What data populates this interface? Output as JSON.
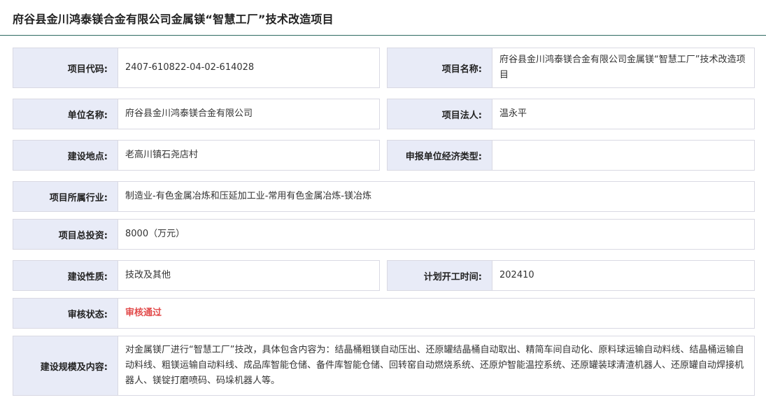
{
  "header": {
    "title": "府谷县金川鸿泰镁合金有限公司金属镁“智慧工厂”技术改造项目"
  },
  "fields": {
    "project_code": {
      "label": "项目代码:",
      "value": "2407-610822-04-02-614028"
    },
    "project_name": {
      "label": "项目名称:",
      "value": "府谷县金川鸿泰镁合金有限公司金属镁“智慧工厂”技术改造项目"
    },
    "unit_name": {
      "label": "单位名称:",
      "value": "府谷县金川鸿泰镁合金有限公司"
    },
    "legal_person": {
      "label": "项目法人:",
      "value": "温永平"
    },
    "location": {
      "label": "建设地点:",
      "value": "老高川镇石尧店村"
    },
    "economic_type": {
      "label": "申报单位经济类型:",
      "value": ""
    },
    "industry": {
      "label": "项目所属行业:",
      "value": "制造业-有色金属冶炼和压延加工业-常用有色金属冶炼-镁冶炼"
    },
    "investment": {
      "label": "项目总投资:",
      "value": "8000（万元）"
    },
    "nature": {
      "label": "建设性质:",
      "value": "技改及其他"
    },
    "start_time": {
      "label": "计划开工时间:",
      "value": "202410"
    },
    "review_status": {
      "label": "审核状态:",
      "value": "审核通过",
      "color": "#e24b4b"
    },
    "scale_content": {
      "label": "建设规模及内容:",
      "value": "对金属镁厂进行“智慧工厂”技改，具体包含内容为：结晶桶粗镁自动压出、还原罐结晶桶自动取出、精简车间自动化、原料球运输自动料线、结晶桶运输自动料线、粗镁运输自动料线、成品库智能仓储、备件库智能仓储、回转窑自动燃烧系统、还原炉智能温控系统、还原罐装球清渣机器人、还原罐自动焊接机器人、镁锭打磨喷码、码垛机器人等。"
    }
  }
}
